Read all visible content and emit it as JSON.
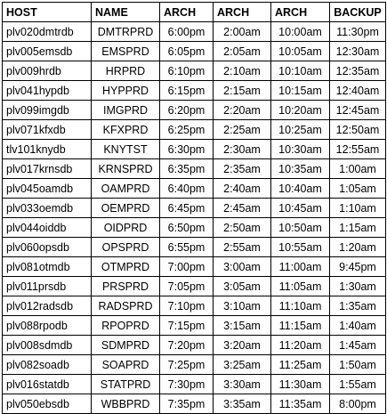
{
  "table": {
    "headers": [
      "HOST",
      "NAME",
      "ARCH",
      "ARCH",
      "ARCH",
      "BACKUP"
    ],
    "rows": [
      [
        "plv020dmtrdb",
        "DMTRPRD",
        "6:00pm",
        "2:00am",
        "10:00am",
        "11:30pm"
      ],
      [
        "plv005emsdb",
        "EMSPRD",
        "6:05pm",
        "2:05am",
        "10:05am",
        "12:30am"
      ],
      [
        "plv009hrdb",
        "HRPRD",
        "6:10pm",
        "2:10am",
        "10:10am",
        "12:35am"
      ],
      [
        "plv041hypdb",
        "HYPPRD",
        "6:15pm",
        "2:15am",
        "10:15am",
        "12:40am"
      ],
      [
        "plv099imgdb",
        "IMGPRD",
        "6:20pm",
        "2:20am",
        "10:20am",
        "12:45am"
      ],
      [
        "plv071kfxdb",
        "KFXPRD",
        "6:25pm",
        "2:25am",
        "10:25am",
        "12:50am"
      ],
      [
        "tlv101knydb",
        "KNYTST",
        "6:30pm",
        "2:30am",
        "10:30am",
        "12:55am"
      ],
      [
        "plv017krnsdb",
        "KRNSPRD",
        "6:35pm",
        "2:35am",
        "10:35am",
        "1:00am"
      ],
      [
        "plv045oamdb",
        "OAMPRD",
        "6:40pm",
        "2:40am",
        "10:40am",
        "1:05am"
      ],
      [
        "plv033oemdb",
        "OEMPRD",
        "6:45pm",
        "2:45am",
        "10:45am",
        "1:10am"
      ],
      [
        "plv044oiddb",
        "OIDPRD",
        "6:50pm",
        "2:50am",
        "10:50am",
        "1:15am"
      ],
      [
        "plv060opsdb",
        "OPSPRD",
        "6:55pm",
        "2:55am",
        "10:55am",
        "1:20am"
      ],
      [
        "plv081otmdb",
        "OTMPRD",
        "7:00pm",
        "3:00am",
        "11:00am",
        "9:45pm"
      ],
      [
        "plv011prsdb",
        "PRSPRD",
        "7:05pm",
        "3:05am",
        "11:05am",
        "1:30am"
      ],
      [
        "plv012radsdb",
        "RADSPRD",
        "7:10pm",
        "3:10am",
        "11:10am",
        "1:35am"
      ],
      [
        "plv088rpodb",
        "RPOPRD",
        "7:15pm",
        "3:15am",
        "11:15am",
        "1:40am"
      ],
      [
        "plv008sdmdb",
        "SDMPRD",
        "7:20pm",
        "3:20am",
        "11:20am",
        "1:45am"
      ],
      [
        "plv082soadb",
        "SOAPRD",
        "7:25pm",
        "3:25am",
        "11:25am",
        "1:50am"
      ],
      [
        "plv016statdb",
        "STATPRD",
        "7:30pm",
        "3:30am",
        "11:30am",
        "1:55am"
      ],
      [
        "plv050ebsdb",
        "WBBPRD",
        "7:35pm",
        "3:35am",
        "11:35am",
        "8:00pm"
      ]
    ]
  }
}
